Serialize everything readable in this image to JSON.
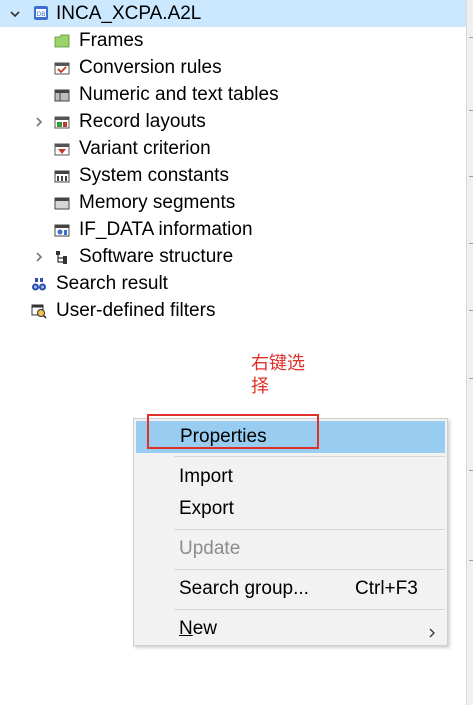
{
  "tree": {
    "root": {
      "label": "INCA_XCPA.A2L",
      "icon": "database-icon"
    },
    "children": [
      {
        "label": "Frames",
        "icon": "folder-icon",
        "expandable": false
      },
      {
        "label": "Conversion rules",
        "icon": "conversion-rules-icon",
        "expandable": false
      },
      {
        "label": "Numeric and text tables",
        "icon": "tables-icon",
        "expandable": false
      },
      {
        "label": "Record layouts",
        "icon": "record-layouts-icon",
        "expandable": true
      },
      {
        "label": "Variant criterion",
        "icon": "variant-criterion-icon",
        "expandable": false
      },
      {
        "label": "System constants",
        "icon": "system-constants-icon",
        "expandable": false
      },
      {
        "label": "Memory segments",
        "icon": "memory-segments-icon",
        "expandable": false
      },
      {
        "label": "IF_DATA information",
        "icon": "if-data-icon",
        "expandable": false
      },
      {
        "label": "Software structure",
        "icon": "software-structure-icon",
        "expandable": true
      }
    ],
    "extras": [
      {
        "label": "Search result",
        "icon": "binoculars-icon"
      },
      {
        "label": "User-defined filters",
        "icon": "filter-icon"
      }
    ]
  },
  "annotation": {
    "line1": "右键选",
    "line2": "择",
    "color": "#e0302a"
  },
  "context_menu": {
    "properties": "Properties",
    "import": "Import",
    "export": "Export",
    "update": "Update",
    "search_group": "Search group...",
    "search_group_shortcut": "Ctrl+F3",
    "new_mnemonic": "N",
    "new_rest": "ew"
  },
  "colors": {
    "selection": "#cce8ff",
    "menu_hover": "#99ccf1",
    "annotation_red": "#e0302a"
  }
}
